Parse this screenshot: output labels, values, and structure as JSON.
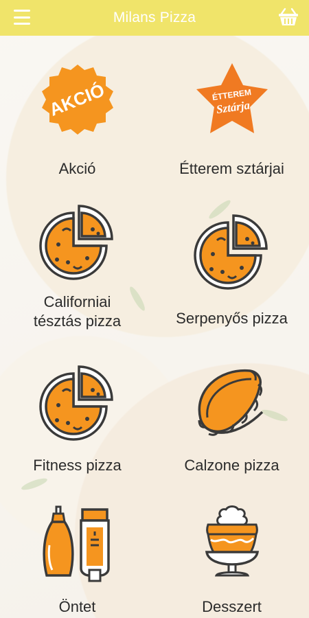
{
  "header": {
    "title": "Milans Pizza",
    "menu_icon": "hamburger-menu-icon",
    "cart_icon": "shopping-basket-icon"
  },
  "badges": {
    "akcio_text": "AKCIÓ",
    "star_line1": "ÉTTEREM",
    "star_line2": "Sztárja"
  },
  "colors": {
    "header_bg": "#f0e46a",
    "accent_orange": "#f5951f",
    "outline_dark": "#3a3a3a"
  },
  "categories": [
    {
      "label": "Akció",
      "icon": "sale-badge-icon"
    },
    {
      "label": "Étterem sztárjai",
      "icon": "star-badge-icon"
    },
    {
      "label_line1": "Californiai",
      "label_line2": "tésztás pizza",
      "icon": "pizza-slice-icon"
    },
    {
      "label": "Serpenyős pizza",
      "icon": "pizza-slice-icon"
    },
    {
      "label": "Fitness pizza",
      "icon": "pizza-slice-icon"
    },
    {
      "label": "Calzone pizza",
      "icon": "calzone-icon"
    },
    {
      "label": "Öntet",
      "icon": "sauce-bottles-icon"
    },
    {
      "label": "Desszert",
      "icon": "dessert-cup-icon"
    }
  ]
}
